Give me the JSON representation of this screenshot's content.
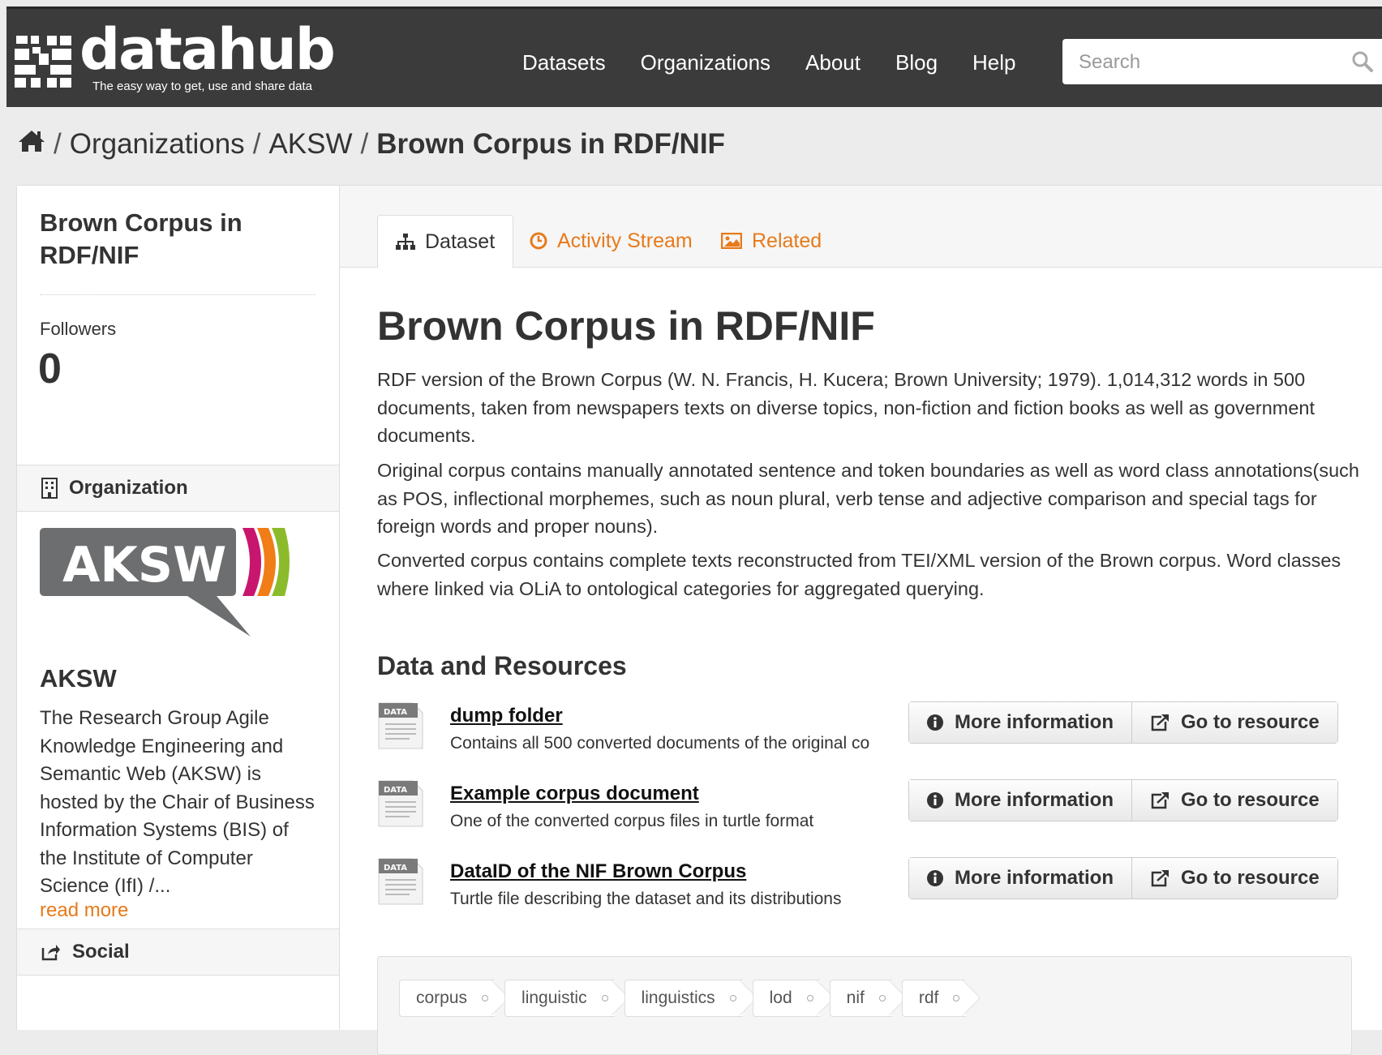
{
  "header": {
    "logo_text": "datahub",
    "tagline": "The easy way to get, use and share data",
    "nav": [
      "Datasets",
      "Organizations",
      "About",
      "Blog",
      "Help"
    ],
    "search_placeholder": "Search"
  },
  "breadcrumb": {
    "home_icon": "home-icon",
    "items": [
      "Organizations",
      "AKSW"
    ],
    "current": "Brown Corpus in RDF/NIF",
    "separator": "/"
  },
  "sidebar": {
    "title": "Brown Corpus in RDF/NIF",
    "followers_label": "Followers",
    "followers_count": "0",
    "organization_heading": "Organization",
    "org_logo_text": "AKSW",
    "org_name": "AKSW",
    "org_description": "The Research Group Agile Knowledge Engineering and Semantic Web (AKSW) is hosted by the Chair of Business Information Systems (BIS) of the Institute of Computer Science (IfI) /...",
    "read_more": "read more",
    "social_heading": "Social"
  },
  "tabs": [
    {
      "label": "Dataset",
      "icon": "sitemap-icon",
      "active": true
    },
    {
      "label": "Activity Stream",
      "icon": "clock-icon",
      "active": false
    },
    {
      "label": "Related",
      "icon": "picture-icon",
      "active": false
    }
  ],
  "dataset": {
    "title": "Brown Corpus in RDF/NIF",
    "paragraphs": [
      "RDF version of the Brown Corpus (W. N. Francis, H. Kucera; Brown University; 1979). 1,014,312 words in 500 documents, taken from newspapers texts on diverse topics, non-fiction and fiction books as well as government documents.",
      "Original corpus contains manually annotated sentence and token boundaries as well as word class annotations(such as POS, inflectional morphemes, such as noun plural, verb tense and adjective comparison and special tags for foreign words and proper nouns).",
      "Converted corpus contains complete texts reconstructed from TEI/XML version of the Brown corpus. Word classes where linked via OLiA to ontological categories for aggregated querying."
    ],
    "resources_heading": "Data and Resources",
    "resources": [
      {
        "name": "dump folder",
        "description": "Contains all 500 converted documents of the original co",
        "format": "DATA"
      },
      {
        "name": "Example corpus document",
        "description": "One of the converted corpus files in turtle format",
        "format": "DATA"
      },
      {
        "name": "DataID of the NIF Brown Corpus",
        "description": "Turtle file describing the dataset and its distributions",
        "format": "DATA"
      }
    ],
    "more_info_label": "More information",
    "go_to_resource_label": "Go to resource",
    "tags": [
      "corpus",
      "linguistic",
      "linguistics",
      "lod",
      "nif",
      "rdf"
    ]
  },
  "colors": {
    "header_bg": "#3b3b3b",
    "accent": "#e77a1b",
    "aksw_gray": "#6d6e70",
    "aksw_magenta": "#c8166f",
    "aksw_orange": "#f07d17",
    "aksw_green": "#8bbb2b"
  }
}
